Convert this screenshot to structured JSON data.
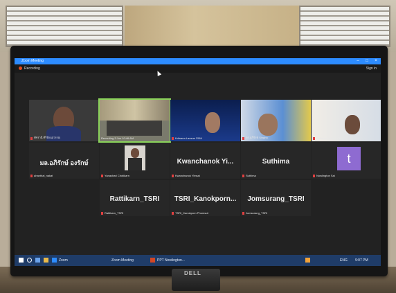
{
  "window": {
    "title": "Zoom Meeting",
    "controls": [
      "–",
      "□",
      "×"
    ],
    "recording_label": "Recording",
    "sign_in": "Sign in"
  },
  "participants": [
    {
      "name": "พัชรานี ศิริรัตนสุวรรณ",
      "type": "video"
    },
    {
      "name": "Recording 3 Jun 10:46 AM",
      "type": "video"
    },
    {
      "name": "Kritsana Laosue 2564",
      "type": "video"
    },
    {
      "name": "ดร.อภิรักษ์ Singha",
      "type": "video"
    },
    {
      "name": "Pattama Pirom TSRI",
      "type": "video"
    },
    {
      "name": "มล.อภิรักษ์ องรักษ์",
      "type": "name",
      "label": "มล.อภิรักษ์ องรักษ์",
      "caption": "ahanthai_nakat"
    },
    {
      "name": "Yanachari Chotikarn",
      "type": "photo"
    },
    {
      "name": "Kwanchanok Yi...",
      "type": "name",
      "label": "Kwanchanok Yi...",
      "caption": "Kwanchanok Yimsai"
    },
    {
      "name": "Suthima",
      "type": "name",
      "label": "Suthima",
      "caption": "Suthima"
    },
    {
      "name": "Nowlington Sai",
      "type": "avatar",
      "letter": "t",
      "caption": "Nowlington Sai"
    },
    {
      "name": "Rattikarn_TSRI",
      "type": "name",
      "label": "Rattikarn_TSRI",
      "caption": "Rattikarn_TSRI"
    },
    {
      "name": "TSRI_Kanokporn...",
      "type": "name",
      "label": "TSRI_Kanokporn...",
      "caption": "TSRI_Kanokporn Phomsuti"
    },
    {
      "name": "Jomsurang_TSRI",
      "type": "name",
      "label": "Jomsurang_TSRI",
      "caption": "Jomsurang_TSRI"
    }
  ],
  "taskbar": {
    "items": [
      "Zoom",
      "Zoom Meeting",
      "PPT Nowlington..."
    ],
    "time": "9:07 PM",
    "lang": "ENG"
  },
  "monitor_brand": "DELL"
}
